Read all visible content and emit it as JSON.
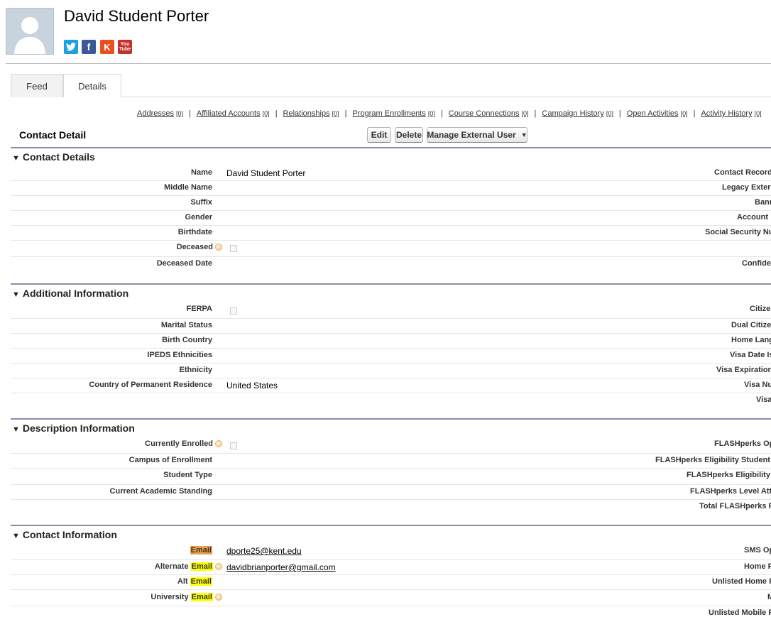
{
  "header": {
    "title": "David Student Porter",
    "social": [
      {
        "icon": "twitter-icon",
        "glyph": "t",
        "color": "#1d9fe3"
      },
      {
        "icon": "facebook-icon",
        "glyph": "f",
        "color": "#3b5998"
      },
      {
        "icon": "klout-icon",
        "glyph": "K",
        "color": "#e8501e"
      },
      {
        "icon": "youtube-icon",
        "glyph": "You Tube",
        "color": "#c4302b"
      }
    ]
  },
  "tabs": {
    "feed": "Feed",
    "details": "Details"
  },
  "related_links": [
    {
      "label": "Addresses",
      "count": "[0]"
    },
    {
      "label": "Affiliated Accounts",
      "count": "[0]"
    },
    {
      "label": "Relationships",
      "count": "[0]"
    },
    {
      "label": "Program Enrollments",
      "count": "[0]"
    },
    {
      "label": "Course Connections",
      "count": "[0]"
    },
    {
      "label": "Campaign History",
      "count": "[0]"
    },
    {
      "label": "Open Activities",
      "count": "[0]"
    },
    {
      "label": "Activity History",
      "count": "[0]"
    }
  ],
  "contact_detail": {
    "title": "Contact Detail",
    "edit": "Edit",
    "delete": "Delete",
    "manage": "Manage External User",
    "manage_arrow": "▼"
  },
  "sections": {
    "contact_details": {
      "title": "Contact Details",
      "rows": [
        {
          "label": "Name",
          "value": "David Student Porter",
          "right": "Contact Record"
        },
        {
          "label": "Middle Name",
          "value": "",
          "right": "Legacy Exter"
        },
        {
          "label": "Suffix",
          "value": "",
          "right": "Bann"
        },
        {
          "label": "Gender",
          "value": "",
          "right": "Account"
        },
        {
          "label": "Birthdate",
          "value": "",
          "right": "Social Security Nu"
        },
        {
          "label": "Deceased",
          "value": "",
          "right": ""
        },
        {
          "label": "Deceased Date",
          "value": "",
          "right": "Confide"
        }
      ]
    },
    "additional_information": {
      "title": "Additional Information",
      "rows": [
        {
          "label": "FERPA",
          "value": "",
          "right": "Citize"
        },
        {
          "label": "Marital Status",
          "value": "",
          "right": "Dual Citize"
        },
        {
          "label": "Birth Country",
          "value": "",
          "right": "Home Lang"
        },
        {
          "label": "IPEDS Ethnicities",
          "value": "",
          "right": "Visa Date Is"
        },
        {
          "label": "Ethnicity",
          "value": "",
          "right": "Visa Expiration"
        },
        {
          "label": "Country of Permanent Residence",
          "value": "United States",
          "right": "Visa Nu"
        },
        {
          "label": "",
          "value": "",
          "right": "Visa"
        }
      ]
    },
    "description_information": {
      "title": "Description Information",
      "rows": [
        {
          "label": "Currently Enrolled",
          "value": "",
          "right": "FLASHperks Op"
        },
        {
          "label": "Campus of Enrollment",
          "value": "",
          "right": "FLASHperks Eligibility Student"
        },
        {
          "label": "Student Type",
          "value": "",
          "right": "FLASHperks Eligibility"
        },
        {
          "label": "Current Academic Standing",
          "value": "",
          "right": "FLASHperks Level Att"
        },
        {
          "label": "",
          "value": "",
          "right": "Total FLASHperks P"
        }
      ]
    },
    "contact_information": {
      "title": "Contact Information",
      "rows": [
        {
          "label": "Email",
          "value": "dporte25@kent.edu",
          "right": "SMS Op"
        },
        {
          "label_prefix": "Alternate",
          "label": "Email",
          "value": "davidbrianporter@gmail.com",
          "right": "Home P"
        },
        {
          "label_prefix": "Alt",
          "label": "Email",
          "value": "",
          "right": "Unlisted Home P"
        },
        {
          "label_prefix": "University",
          "label": "Email",
          "value": "",
          "right": "M"
        },
        {
          "label": "",
          "value": "",
          "right": "Unlisted Mobile P"
        }
      ]
    }
  }
}
